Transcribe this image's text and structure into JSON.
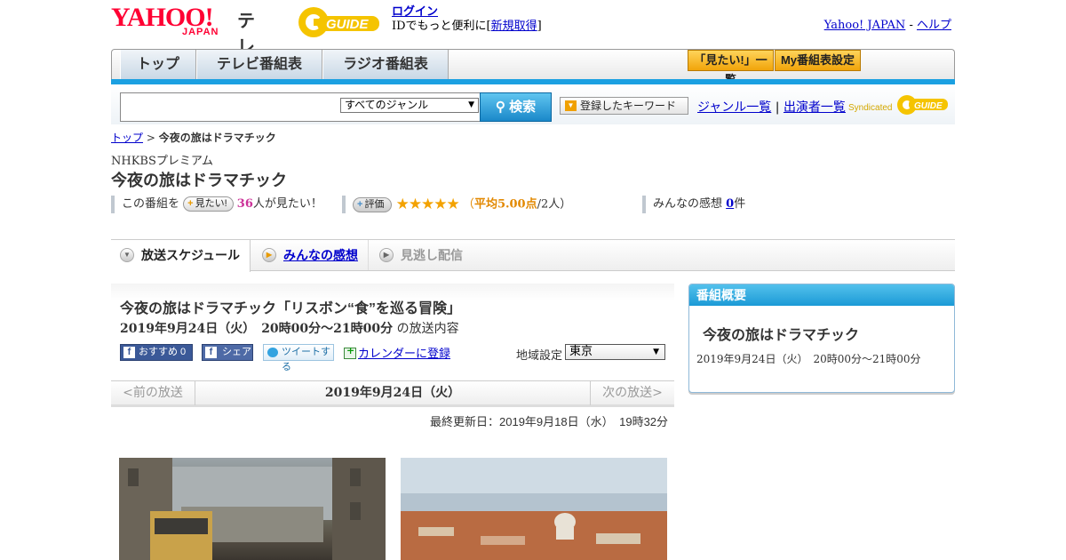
{
  "header": {
    "logo_yahoo": "YAHOO!",
    "logo_japan": "JAPAN",
    "logo_tv": "テレビ",
    "gguide_text": "GUIDE",
    "login_label": "ログイン",
    "id_prompt_prefix": "IDでもっと便利に[",
    "register_label": "新規取得",
    "id_prompt_suffix": "]",
    "yahoo_japan_link": "Yahoo! JAPAN",
    "separator": "-",
    "help_link": "ヘルプ"
  },
  "nav": {
    "tabs": [
      {
        "label": "トップ"
      },
      {
        "label": "テレビ番組表"
      },
      {
        "label": "ラジオ番組表"
      }
    ],
    "want_list_button": "「見たい!」一覧",
    "my_schedule_button": "My番組表設定"
  },
  "search": {
    "placeholder": "",
    "genre_selected": "すべてのジャンル",
    "search_button": "検索",
    "keyword_button": "登録したキーワード",
    "genre_list_link": "ジャンル一覧",
    "link_separator": "|",
    "performer_list_link": "出演者一覧",
    "syndicated_label": "Syndicated",
    "syndicated_brand": "GUIDE"
  },
  "breadcrumb": {
    "top": "トップ",
    "sep": ">",
    "current": "今夜の旅はドラマチック"
  },
  "program": {
    "channel": "NHKBSプレミアム",
    "title": "今夜の旅はドラマチック"
  },
  "stats": {
    "this_program_label": "この番組を",
    "want_button": "見たい!",
    "want_count": "36",
    "want_suffix": "人が見たい！",
    "rate_button": "評価",
    "stars": "★★★★★",
    "avg_open": "（",
    "avg_label": "平均5.00点",
    "avg_suffix": "/2人）",
    "impressions_label": "みんなの感想",
    "impressions_count": "0",
    "impressions_suffix": "件"
  },
  "content_tabs": [
    {
      "label": "放送スケジュール"
    },
    {
      "label": "みんなの感想"
    },
    {
      "label": "見逃し配信"
    }
  ],
  "episode": {
    "title": "今夜の旅はドラマチック「リスボン“食”を巡る冒険」",
    "date_time": "2019年9月24日（火）　20時00分～21時00分",
    "date_time_suffix": "の放送内容",
    "fb_recommend": "おすすめ 0",
    "fb_share": "シェア",
    "tweet": "ツイートする",
    "calendar": "カレンダーに登録",
    "region_label": "地域設定",
    "region_selected": "東京"
  },
  "date_nav": {
    "prev": "<前の放送",
    "current": "2019年9月24日（火）",
    "next": "次の放送>"
  },
  "updated": "最終更新日：2019年9月18日（水）　19時32分",
  "overview": {
    "heading": "番組概要",
    "title": "今夜の旅はドラマチック",
    "time": "2019年9月24日（火）　20時00分～21時00分"
  }
}
